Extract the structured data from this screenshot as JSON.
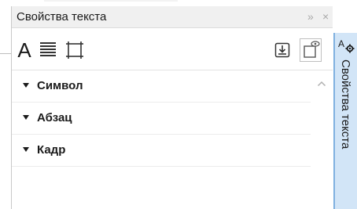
{
  "panel": {
    "title": "Свойства текста"
  },
  "title_buttons": {
    "collapse_glyph": "»",
    "close_glyph": "×"
  },
  "toolbar": {
    "character_glyph": "A"
  },
  "sections": [
    {
      "label": "Символ"
    },
    {
      "label": "Абзац"
    },
    {
      "label": "Кадр"
    }
  ],
  "sidetab": {
    "label": "Свойства текста"
  },
  "icons": {
    "collapse": "double-chevron-right-icon",
    "close": "close-icon",
    "character": "character-icon",
    "paragraph": "paragraph-icon",
    "frame": "frame-icon",
    "import": "import-icon",
    "view": "view-icon",
    "scroll_up": "chevron-up-icon",
    "sidetab": "text-properties-icon"
  },
  "colors": {
    "titlebar": "#f0f0f0",
    "sidetab": "#d2e5f7",
    "sidetab_border": "#7fb0e0",
    "text": "#1a1a1a"
  }
}
